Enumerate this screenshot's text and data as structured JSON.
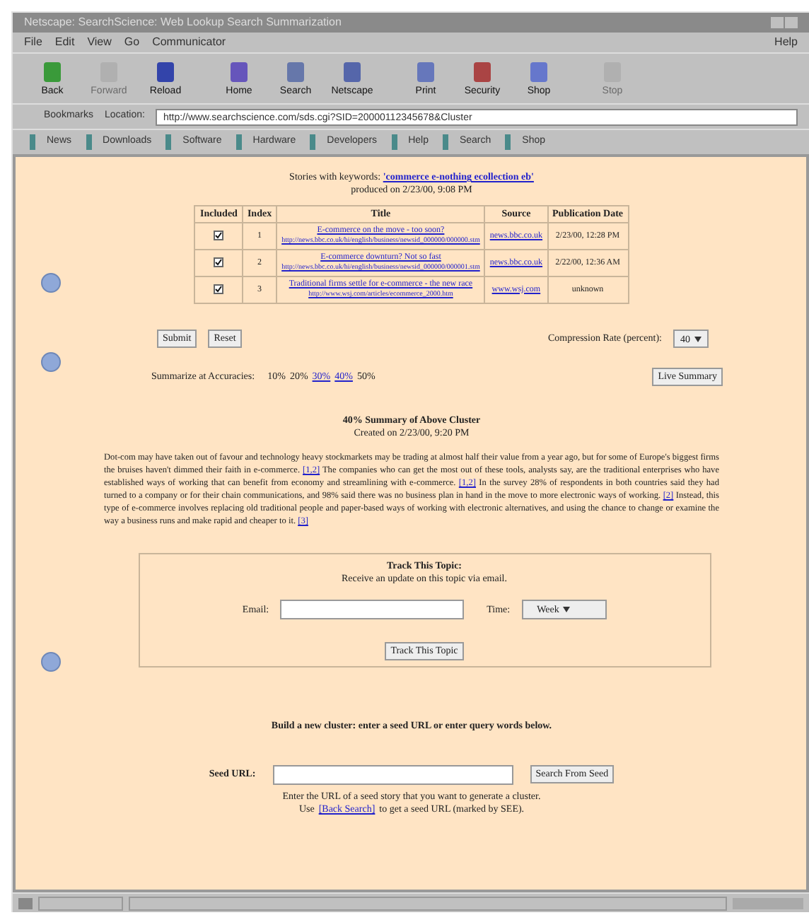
{
  "window": {
    "title": "Netscape: SearchScience: Web Lookup Search Summarization"
  },
  "menu": [
    "File",
    "Edit",
    "View",
    "Go",
    "Communicator",
    "Help"
  ],
  "toolbar": [
    {
      "label": "Back",
      "disabled": false
    },
    {
      "label": "Forward",
      "disabled": true
    },
    {
      "label": "Reload",
      "disabled": false
    },
    {
      "label": "Home",
      "disabled": false
    },
    {
      "label": "Search",
      "disabled": false
    },
    {
      "label": "Netscape",
      "disabled": false
    },
    {
      "label": "Print",
      "disabled": false
    },
    {
      "label": "Security",
      "disabled": false
    },
    {
      "label": "Shop",
      "disabled": false
    },
    {
      "label": "Stop",
      "disabled": true
    }
  ],
  "location": {
    "bookmarks": "Bookmarks",
    "label": "Location:",
    "url": "http://www.searchscience.com/sds.cgi?SID=20000112345678&Cluster"
  },
  "personal_toolbar": [
    "News",
    "Downloads",
    "Software",
    "Hardware",
    "Developers",
    "Help",
    "Search",
    "Shop"
  ],
  "header": {
    "prefix": "Stories with keywords:",
    "keywords": "'commerce e-nothing ecollection eb'",
    "produced": "produced on 2/23/00, 9:08 PM"
  },
  "table": {
    "columns": [
      "Included",
      "Index",
      "Title",
      "Source",
      "Publication Date"
    ],
    "rows": [
      {
        "included": true,
        "index": "1",
        "title": "E-commerce on the move - too soon?",
        "url": "http://news.bbc.co.uk/hi/english/business/newsid_000000/000000.stm",
        "source": "news.bbc.co.uk",
        "date": "2/23/00, 12:28 PM"
      },
      {
        "included": true,
        "index": "2",
        "title": "E-commerce downturn? Not so fast",
        "url": "http://news.bbc.co.uk/hi/english/business/newsid_000000/000001.stm",
        "source": "news.bbc.co.uk",
        "date": "2/22/00, 12:36 AM"
      },
      {
        "included": true,
        "index": "3",
        "title": "Traditional firms settle for e-commerce - the new race",
        "url": "http://www.wsj.com/articles/ecommerce_2000.htm",
        "source": "www.wsj.com",
        "date": "unknown"
      }
    ]
  },
  "buttons": [
    "Submit",
    "Reset"
  ],
  "compression": {
    "label": "Compression Rate (percent):",
    "value": "40"
  },
  "summarize": {
    "label": "Summarize at Accuracies:",
    "levels": [
      {
        "text": "10%",
        "link": false
      },
      {
        "text": "20%",
        "link": false
      },
      {
        "text": "30%",
        "link": true
      },
      {
        "text": "40%",
        "link": true
      },
      {
        "text": "50%",
        "link": false
      }
    ],
    "button": "Live Summary"
  },
  "summary": {
    "title": "40% Summary of Above Cluster",
    "created": "Created on 2/23/00, 9:20 PM",
    "parts": [
      {
        "text": "Dot-com may have taken out of favour and technology heavy stockmarkets may be trading at almost half their value from a year ago, but for some of Europe's biggest firms the bruises haven't dimmed their faith in e-commerce. ",
        "cite": "[1,2]"
      },
      {
        "text": " The companies who can get the most out of these tools, analysts say, are the traditional enterprises who have established ways of working that can benefit from economy and streamlining with e-commerce. ",
        "cite": "[1,2]"
      },
      {
        "text": " In the survey 28% of respondents in both countries said they had turned to a company or for their chain communications, and 98% said there was no business plan in hand in the move to more electronic ways of working. ",
        "cite": "[2]"
      },
      {
        "text": " Instead, this type of e-commerce involves replacing old traditional people and paper-based ways of working with electronic alternatives, and using the chance to change or examine the way a business runs and make rapid and cheaper to it. ",
        "cite": "[3]"
      }
    ]
  },
  "track": {
    "title": "Track This Topic:",
    "subtitle": "Receive an update on this topic via email.",
    "email_label": "Email:",
    "time_label": "Time:",
    "time_value": "Week",
    "button": "Track This Topic"
  },
  "build": {
    "heading": "Build a new cluster: enter a seed URL or enter query words below.",
    "seed_label": "Seed URL:",
    "button": "Search From Seed",
    "note": "Enter the URL of a seed story that you want to generate a cluster.",
    "use": "Use",
    "link": "[Back Search]",
    "after": "to get a seed URL (marked by SEE)."
  }
}
